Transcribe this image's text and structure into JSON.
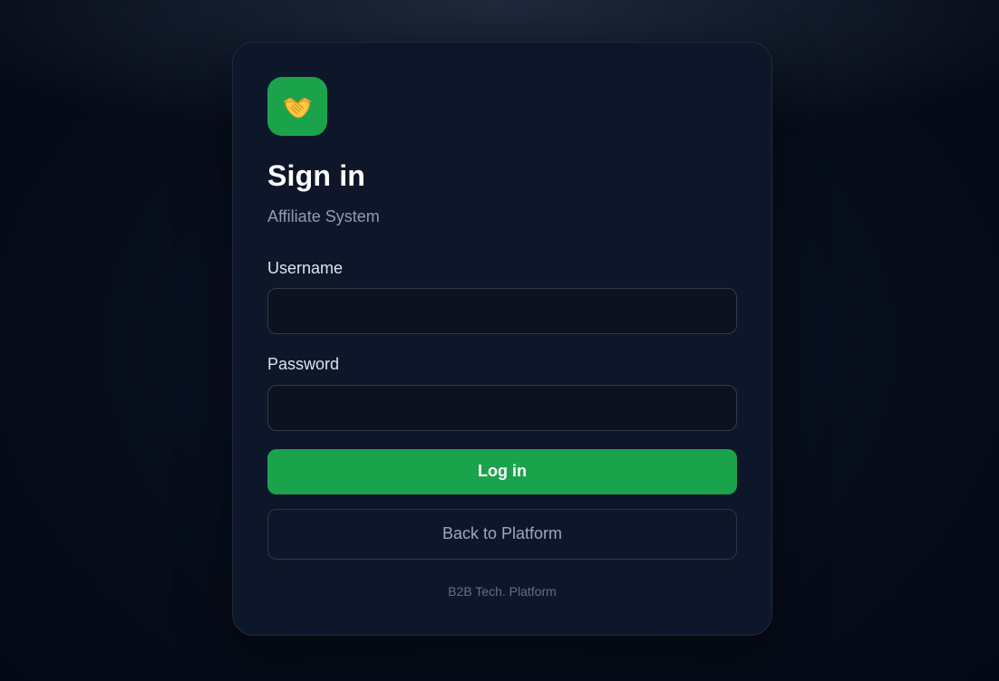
{
  "login": {
    "logo_icon": "handshake-icon",
    "title": "Sign in",
    "subtitle": "Affiliate System",
    "username_label": "Username",
    "username_value": "",
    "password_label": "Password",
    "password_value": "",
    "login_button": "Log in",
    "back_button": "Back to Platform",
    "footer": "B2B Tech. Platform"
  },
  "colors": {
    "accent": "#1ba34b",
    "card": "#0e1729",
    "page_background": "#050b18"
  }
}
